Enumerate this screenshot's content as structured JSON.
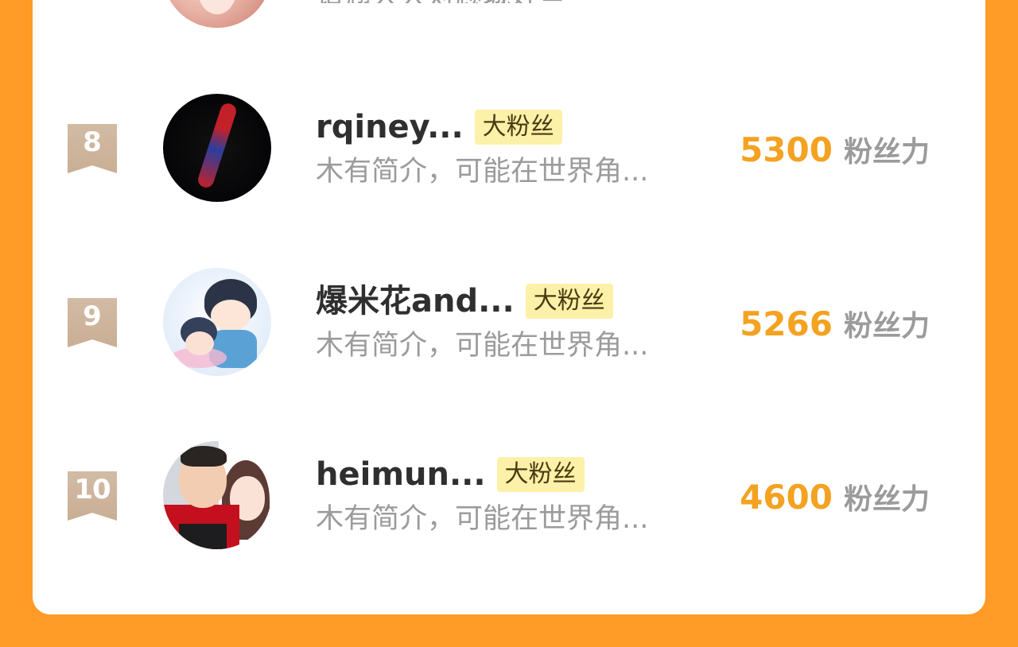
{
  "partial_row": {
    "desc": "请翘大大对顾城好些"
  },
  "rows": [
    {
      "rank": "8",
      "name": "rqiney...",
      "badge": "大粉丝",
      "desc": "木有简介，可能在世界角...",
      "score": "5300",
      "score_unit": "粉丝力"
    },
    {
      "rank": "9",
      "name": "爆米花and...",
      "badge": "大粉丝",
      "desc": "木有简介，可能在世界角...",
      "score": "5266",
      "score_unit": "粉丝力"
    },
    {
      "rank": "10",
      "name": "heimun...",
      "badge": "大粉丝",
      "desc": "木有简介，可能在世界角...",
      "score": "4600",
      "score_unit": "粉丝力"
    }
  ],
  "colors": {
    "page_bg": "#ff9b26",
    "card_bg": "#ffffff",
    "score": "#f4a221",
    "badge_bg": "#fdf0a8",
    "rank_ribbon": "#cdb49b",
    "muted_text": "#9b9b9b"
  },
  "icons": {
    "rank_ribbon": "ribbon-bookmark-icon"
  }
}
